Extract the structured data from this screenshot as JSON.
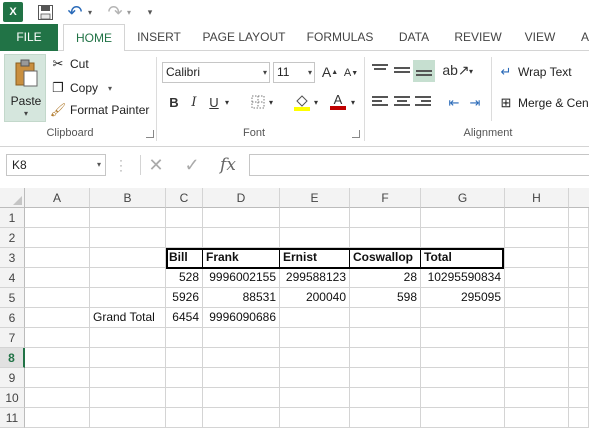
{
  "qat": {
    "logo": "X",
    "save": "save-icon",
    "undo": "↶",
    "redo": "↷",
    "dropdown": "▾",
    "more": "▾"
  },
  "tabs": [
    "FILE",
    "HOME",
    "INSERT",
    "PAGE LAYOUT",
    "FORMULAS",
    "DATA",
    "REVIEW",
    "VIEW",
    "A"
  ],
  "clipboard": {
    "paste": "Paste",
    "cut": "Cut",
    "copy": "Copy",
    "format_painter": "Format Painter",
    "group": "Clipboard"
  },
  "font": {
    "name": "Calibri",
    "size": "11",
    "grow": "A",
    "shrink": "A",
    "bold": "B",
    "italic": "I",
    "underline": "U",
    "font_color_letter": "A",
    "group": "Font"
  },
  "alignment": {
    "wrap_text": "Wrap Text",
    "merge": "Merge & Cen",
    "group": "Alignment"
  },
  "formula_bar": {
    "namebox": "K8",
    "cancel": "✕",
    "enter": "✓",
    "fx": "fx",
    "formula": ""
  },
  "columns": [
    "A",
    "B",
    "C",
    "D",
    "E",
    "F",
    "G",
    "H"
  ],
  "rows": [
    "1",
    "2",
    "3",
    "4",
    "5",
    "6",
    "7",
    "8",
    "9",
    "10",
    "11"
  ],
  "active_row": "8",
  "cells": {
    "c3": "Bill",
    "d3": "Frank",
    "e3": "Ernist",
    "f3": "Coswallop",
    "g3": "Total",
    "c4": "528",
    "d4": "9996002155",
    "e4": "299588123",
    "f4": "28",
    "g4": "10295590834",
    "c5": "5926",
    "d5": "88531",
    "e5": "200040",
    "f5": "598",
    "g5": "295095",
    "b6": "Grand Total",
    "c6": "6454",
    "d6": "9996090686"
  },
  "colors": {
    "accent": "#217346",
    "font_highlight": "#ffff00",
    "font_color": "#c00000"
  }
}
